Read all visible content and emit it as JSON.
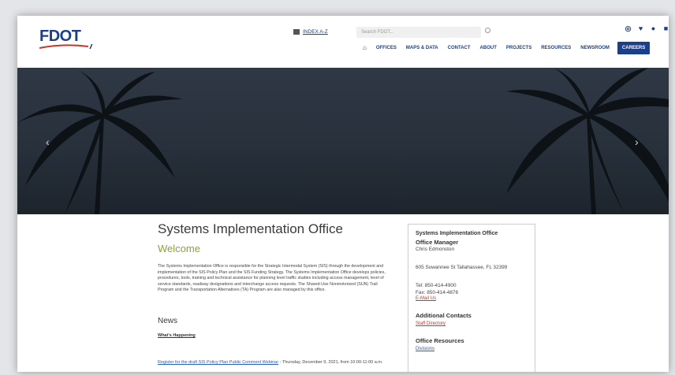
{
  "header": {
    "logo_text": "FDOT",
    "index_label": "INDEX A-Z",
    "search_placeholder": "Search FDOT...",
    "nav": [
      "OFFICES",
      "MAPS & DATA",
      "CONTACT",
      "ABOUT",
      "PROJECTS",
      "RESOURCES",
      "NEWSROOM"
    ],
    "careers": "CAREERS",
    "brand_color": "#1b3f8b"
  },
  "main": {
    "title": "Systems Implementation Office",
    "welcome": "Welcome",
    "intro": "The Systems Implementation Office is responsible for the Strategic Intermodal System (SIS) through the development and implementation of the SIS Policy Plan and the SIS Funding Strategy. The Systems Implementation Office develops policies, procedures, tools, training and technical assistance for planning level traffic studies including access management, level of service standards, roadway designations and interchange access requests. The Shared-Use Nonmotorized (SUN) Trail Program and the Transportation Alternatives (TA) Program are also managed by this office.",
    "news_heading": "News",
    "whats_happening": "What's Happening",
    "news_link": "Register for the draft SIS Policy Plan Public Comment Webinar",
    "news_detail": " - Thursday, December 9, 2021, from 10:00-11:00 a.m."
  },
  "sidebar": {
    "title": "Systems Implementation Office",
    "role": "Office Manager",
    "manager": "Chris Edmonston",
    "address": "605 Suwannee St Tallahassee, FL 32399",
    "tel": "Tel: 850-414-4900",
    "fax": "Fax: 850-414-4876",
    "email": "E-Mail Us",
    "contacts_heading": "Additional Contacts",
    "staff_directory": "Staff Directory",
    "resources_heading": "Office Resources",
    "divisions": "Divisions"
  }
}
